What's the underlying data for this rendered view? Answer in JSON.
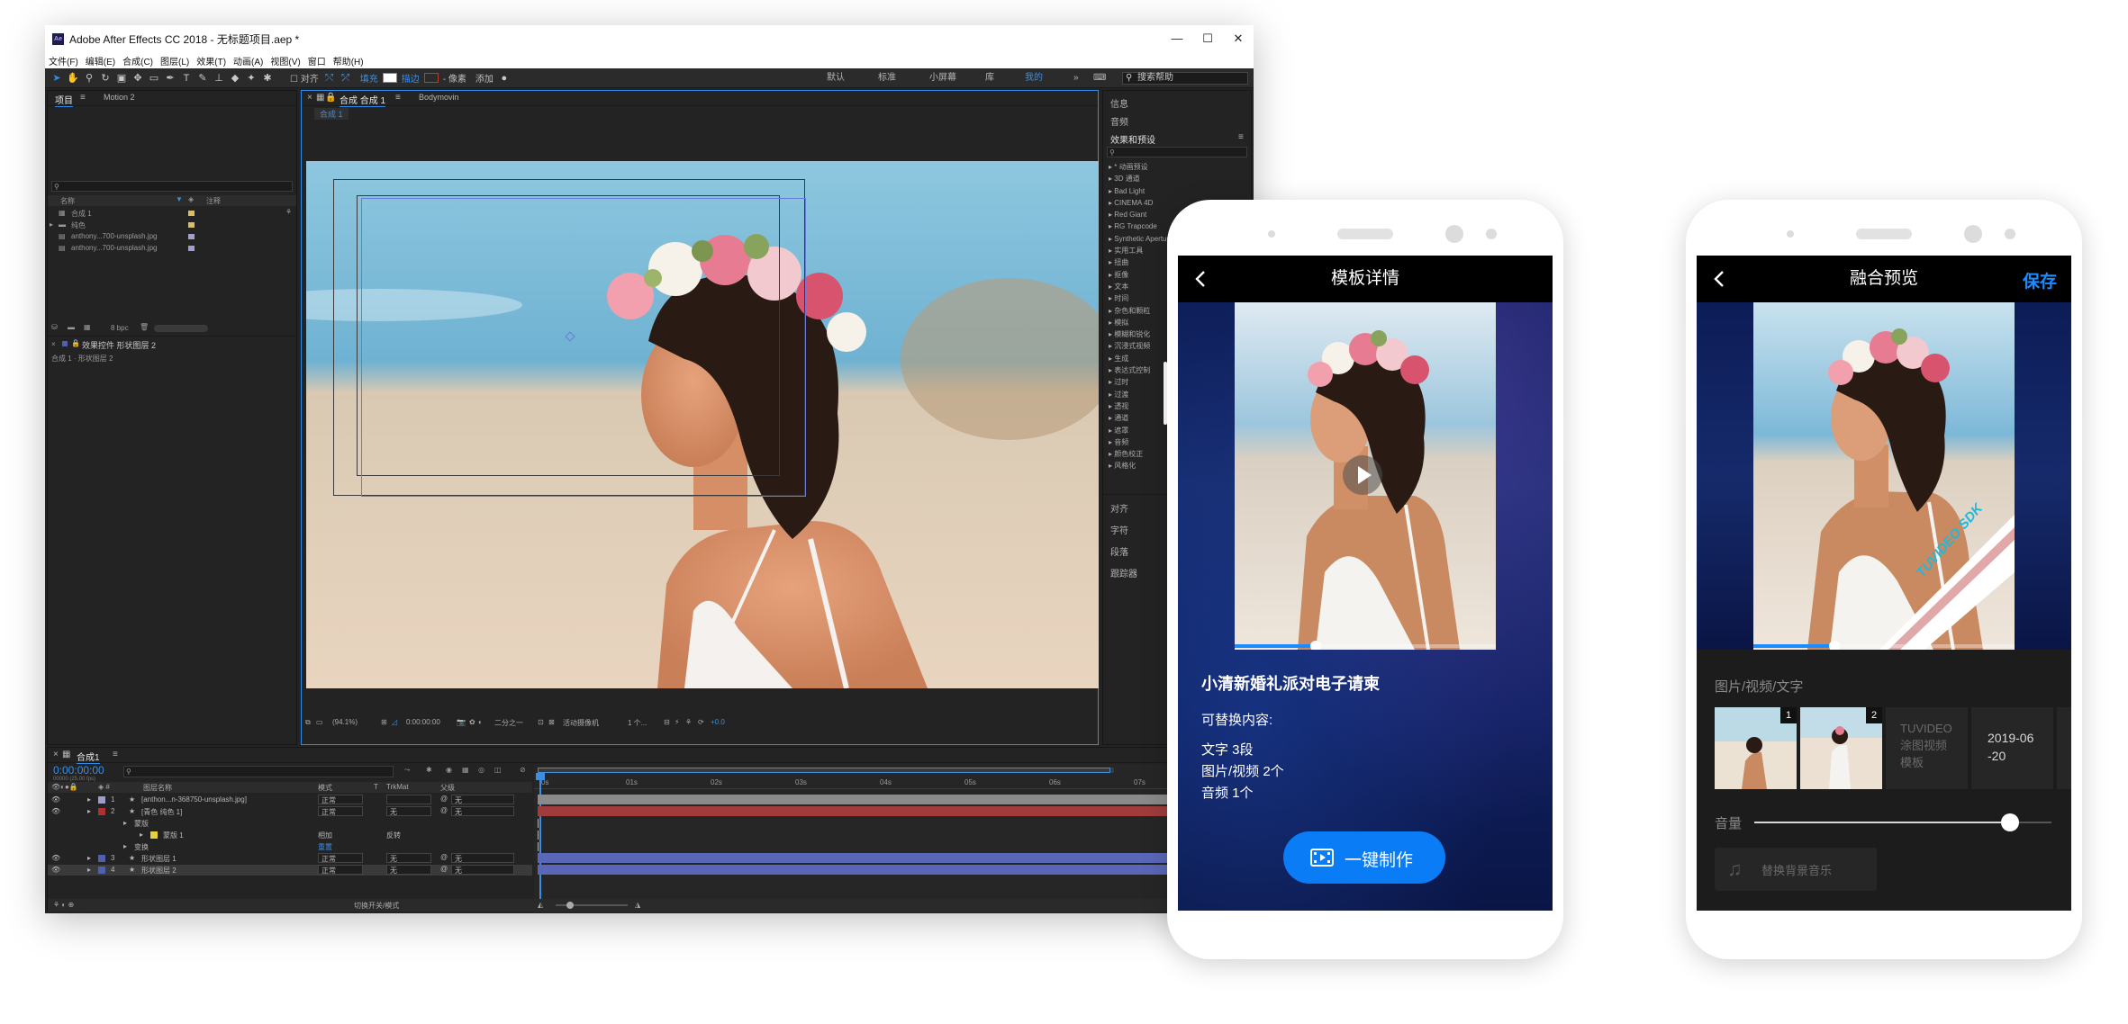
{
  "ae": {
    "window_title": "Adobe After Effects CC 2018 - 无标题项目.aep *",
    "logo_text": "Ae",
    "menu": [
      "文件(F)",
      "编辑(E)",
      "合成(C)",
      "图层(L)",
      "效果(T)",
      "动画(A)",
      "视图(V)",
      "窗口",
      "帮助(H)"
    ],
    "toolbar": {
      "align_label": "对齐",
      "fill_label": "填充",
      "stroke_label": "描边",
      "px_label": "- 像素",
      "add_label": "添加",
      "workspaces": [
        "默认",
        "标准",
        "小屏幕",
        "库",
        "我的"
      ],
      "search_help_placeholder": "搜索帮助",
      "fill_color": "#ffffff",
      "stroke_color": "#c0392b"
    },
    "project_panel": {
      "tabs": [
        "项目",
        "Motion 2"
      ],
      "columns": [
        "名称",
        "注释"
      ],
      "items": [
        {
          "name": "合成 1",
          "color": "#d8c060"
        },
        {
          "name": "纯色",
          "color": "#d8c060"
        },
        {
          "name": "anthony...700-unsplash.jpg",
          "color": "#a0a0d0"
        },
        {
          "name": "anthony...700-unsplash.jpg",
          "color": "#a0a0d0"
        }
      ],
      "bpc": "8 bpc",
      "effects_tab": "效果控件 形状图层 2",
      "effects_line": "合成 1 · 形状图层 2"
    },
    "comp_panel": {
      "tabs": [
        "合成 合成 1",
        "Bodymovin"
      ],
      "subtab": "合成 1",
      "footer": {
        "zoom": "(94.1%)",
        "time": "0:00:00:00",
        "resolution": "二分之一",
        "camera": "活动摄像机",
        "views": "1 个...",
        "exposure": "+0.0"
      }
    },
    "right_panel": {
      "top_items": [
        "信息",
        "音频"
      ],
      "effects_title": "效果和预设",
      "effects": [
        "* 动画预设",
        "3D 通道",
        "Bad Light",
        "CINEMA 4D",
        "Red Giant",
        "RG Trapcode",
        "Synthetic Aperture",
        "实用工具",
        "扭曲",
        "抠像",
        "文本",
        "时间",
        "杂色和颗粒",
        "模拟",
        "模糊和锐化",
        "沉浸式视频",
        "生成",
        "表达式控制",
        "过时",
        "过渡",
        "透视",
        "通道",
        "遮罩",
        "音频",
        "颜色校正",
        "风格化"
      ],
      "bottom_items": [
        "对齐",
        "字符",
        "段落",
        "跟踪器"
      ]
    },
    "timeline": {
      "tab": "合成1",
      "timecode": "0:00:00:00",
      "fps": "00000 (25.00 fps)",
      "columns": [
        "图层名称",
        "模式",
        "T",
        "TrkMat",
        "父级"
      ],
      "rows": [
        {
          "num": "1",
          "name": "[anthon...n-368750-unsplash.jpg]",
          "mode": "正常",
          "trk": "",
          "parent": "无",
          "color": "#9d9dc8",
          "bar": "#8a8a8a"
        },
        {
          "num": "2",
          "name": "[青色 纯色 1]",
          "mode": "正常",
          "trk": "无",
          "parent": "无",
          "color": "#b03030",
          "bar": "#a03c3c"
        },
        {
          "num": "",
          "name": "蒙版",
          "mode": "",
          "trk": "",
          "parent": "",
          "color": "",
          "bar": ""
        },
        {
          "num": "",
          "name": "蒙版 1",
          "mode": "相加",
          "trk": "反转",
          "parent": "",
          "color": "#e8d040",
          "bar": ""
        },
        {
          "num": "",
          "name": "变换",
          "mode": "重置",
          "trk": "",
          "parent": "",
          "color": "",
          "bar": ""
        },
        {
          "num": "3",
          "name": "形状图层 1",
          "mode": "正常",
          "trk": "无",
          "parent": "无",
          "color": "#5060b0",
          "bar": "#5a67b8"
        },
        {
          "num": "4",
          "name": "形状图层 2",
          "mode": "正常",
          "trk": "无",
          "parent": "无",
          "color": "#5060b0",
          "bar": "#5a67b8"
        }
      ],
      "ruler": [
        "0s",
        "01s",
        "02s",
        "03s",
        "04s",
        "05s",
        "06s",
        "07s"
      ],
      "footer": "切换开关/模式"
    }
  },
  "phone1": {
    "title": "模板详情",
    "template_name": "小清新婚礼派对电子请柬",
    "replace_title": "可替换内容:",
    "replace_items": [
      "文字 3段",
      "图片/视频 2个",
      "音频 1个"
    ],
    "cta_label": "一键制作",
    "progress": 0.31,
    "accent": "#0a7cf5"
  },
  "phone2": {
    "title": "融合预览",
    "save_label": "保存",
    "watermark": "TUVIDEO SDK",
    "section_title": "图片/视频/文字",
    "thumb_badges": [
      "1",
      "2"
    ],
    "text_card1": [
      "TUVIDEO",
      "涂图视频",
      "模板"
    ],
    "text_card2": [
      "2019-06",
      "-20"
    ],
    "volume_label": "音量",
    "volume": 0.86,
    "progress": 0.31,
    "music_label": "替换背景音乐",
    "accent": "#1a8cff"
  }
}
